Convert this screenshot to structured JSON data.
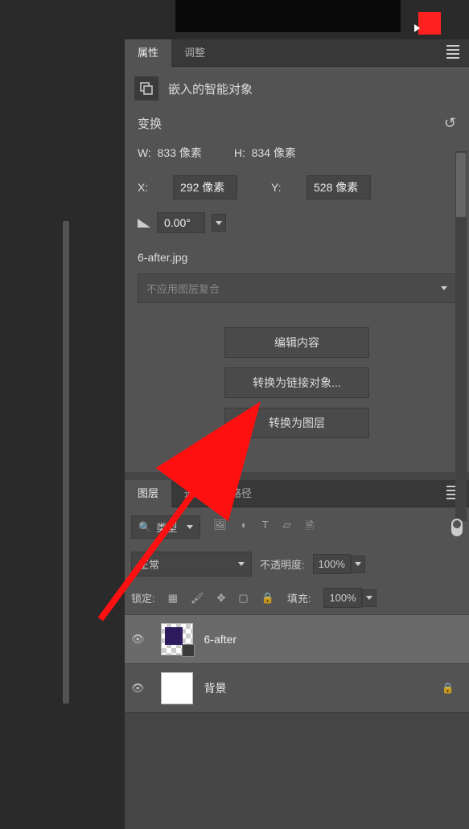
{
  "top_tabs": {
    "properties": "属性",
    "adjustments": "调整"
  },
  "smart_object_label": "嵌入的智能对象",
  "transform": {
    "title": "变换",
    "w_label": "W:",
    "w_value": "833 像素",
    "h_label": "H:",
    "h_value": "834 像素",
    "x_label": "X:",
    "x_value": "292 像素",
    "y_label": "Y:",
    "y_value": "528 像素",
    "angle": "0.00°"
  },
  "filename": "6-after.jpg",
  "layer_comp_placeholder": "不应用图层复合",
  "buttons": {
    "edit_content": "编辑内容",
    "convert_linked": "转换为链接对象...",
    "convert_layer": "转换为图层"
  },
  "layers": {
    "tabs": {
      "layers": "图层",
      "channels": "通道",
      "paths": "路径"
    },
    "filter_type": "类型",
    "blend_mode": "正常",
    "opacity_label": "不透明度:",
    "opacity_value": "100%",
    "lock_label": "锁定:",
    "fill_label": "填充:",
    "fill_value": "100%",
    "items": [
      {
        "name": "6-after",
        "locked": false
      },
      {
        "name": "背景",
        "locked": true
      }
    ]
  }
}
